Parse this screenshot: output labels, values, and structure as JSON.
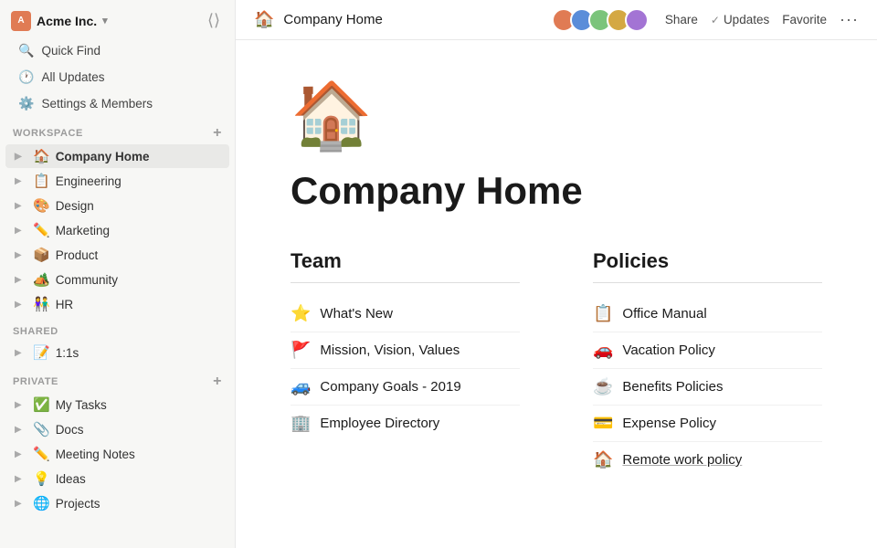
{
  "workspace": {
    "name": "Acme Inc.",
    "avatar_initials": "A"
  },
  "topbar": {
    "page_icon": "🏠",
    "page_title": "Company Home",
    "share_label": "Share",
    "updates_label": "Updates",
    "favorite_label": "Favorite"
  },
  "sidebar": {
    "quick_find": "Quick Find",
    "all_updates": "All Updates",
    "settings": "Settings & Members",
    "workspace_label": "WORKSPACE",
    "workspace_items": [
      {
        "id": "company-home",
        "icon": "🏠",
        "label": "Company Home",
        "active": true
      },
      {
        "id": "engineering",
        "icon": "📋",
        "label": "Engineering"
      },
      {
        "id": "design",
        "icon": "🎨",
        "label": "Design"
      },
      {
        "id": "marketing",
        "icon": "✏️",
        "label": "Marketing"
      },
      {
        "id": "product",
        "icon": "📦",
        "label": "Product"
      },
      {
        "id": "community",
        "icon": "🏕️",
        "label": "Community"
      },
      {
        "id": "hr",
        "icon": "👫",
        "label": "HR"
      }
    ],
    "shared_label": "SHARED",
    "shared_items": [
      {
        "id": "1-1s",
        "icon": "📝",
        "label": "1:1s"
      }
    ],
    "private_label": "PRIVATE",
    "private_items": [
      {
        "id": "my-tasks",
        "icon": "✅",
        "label": "My Tasks"
      },
      {
        "id": "docs",
        "icon": "📎",
        "label": "Docs"
      },
      {
        "id": "meeting-notes",
        "icon": "✏️",
        "label": "Meeting Notes"
      },
      {
        "id": "ideas",
        "icon": "💡",
        "label": "Ideas"
      },
      {
        "id": "projects",
        "icon": "🌐",
        "label": "Projects"
      }
    ]
  },
  "page": {
    "hero_icon": "🏠",
    "title": "Company Home",
    "team_section": {
      "title": "Team",
      "items": [
        {
          "icon": "⭐",
          "label": "What's New"
        },
        {
          "icon": "🚩",
          "label": "Mission, Vision, Values"
        },
        {
          "icon": "🚙",
          "label": "Company Goals - 2019"
        },
        {
          "icon": "🏢",
          "label": "Employee Directory"
        }
      ]
    },
    "policies_section": {
      "title": "Policies",
      "items": [
        {
          "icon": "📋",
          "label": "Office Manual"
        },
        {
          "icon": "🚗",
          "label": "Vacation Policy"
        },
        {
          "icon": "☕",
          "label": "Benefits Policies"
        },
        {
          "icon": "💳",
          "label": "Expense Policy"
        },
        {
          "icon": "🏠",
          "label": "Remote work policy",
          "underline": true
        }
      ]
    }
  },
  "avatars": [
    {
      "color": "#e07b54"
    },
    {
      "color": "#5b8dd9"
    },
    {
      "color": "#7bc47b"
    },
    {
      "color": "#d4a843"
    },
    {
      "color": "#a374d4"
    }
  ]
}
